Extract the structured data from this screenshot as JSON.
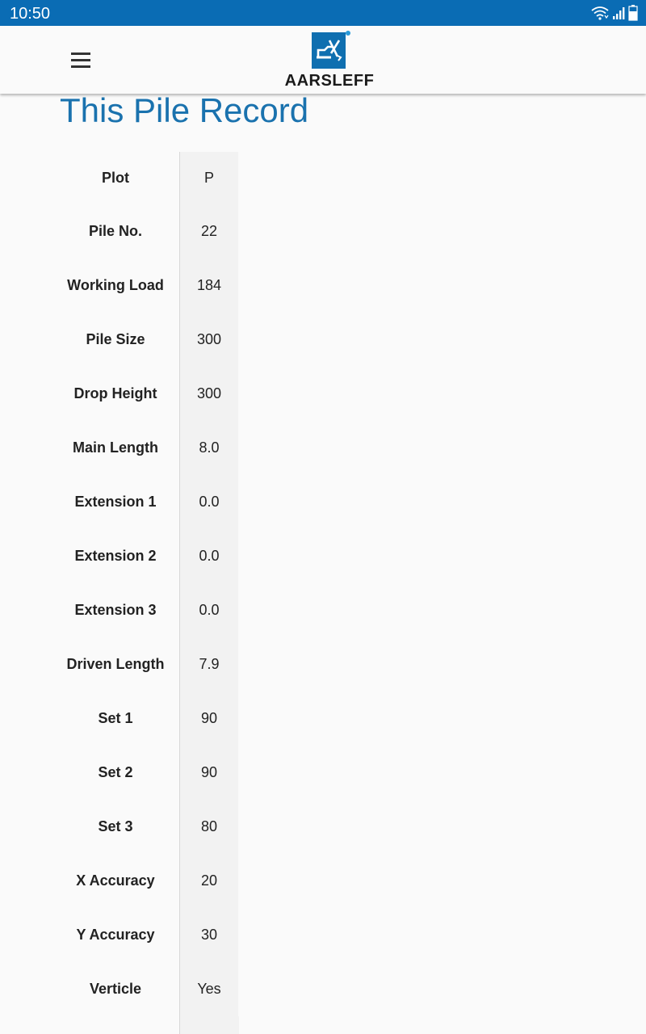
{
  "status_bar": {
    "time": "10:50",
    "icons": [
      "wifi-icon",
      "signal-icon",
      "battery-icon"
    ],
    "background_color": "#0a6cb4"
  },
  "app_bar": {
    "menu_icon": "hamburger-menu-icon",
    "logo_text": "AARSLEFF"
  },
  "page": {
    "title": "This Pile Record",
    "title_color": "#1a72ae"
  },
  "record": {
    "rows": [
      {
        "label": "Plot",
        "value": "P"
      },
      {
        "label": "Pile No.",
        "value": "22"
      },
      {
        "label": "Working Load",
        "value": "184"
      },
      {
        "label": "Pile Size",
        "value": "300"
      },
      {
        "label": "Drop Height",
        "value": "300"
      },
      {
        "label": "Main Length",
        "value": "8.0"
      },
      {
        "label": "Extension 1",
        "value": "0.0"
      },
      {
        "label": "Extension 2",
        "value": "0.0"
      },
      {
        "label": "Extension 3",
        "value": "0.0"
      },
      {
        "label": "Driven Length",
        "value": "7.9"
      },
      {
        "label": "Set 1",
        "value": "90"
      },
      {
        "label": "Set 2",
        "value": "90"
      },
      {
        "label": "Set 3",
        "value": "80"
      },
      {
        "label": "X Accuracy",
        "value": "20"
      },
      {
        "label": "Y Accuracy",
        "value": "30"
      },
      {
        "label": "Verticle",
        "value": "Yes"
      }
    ]
  }
}
